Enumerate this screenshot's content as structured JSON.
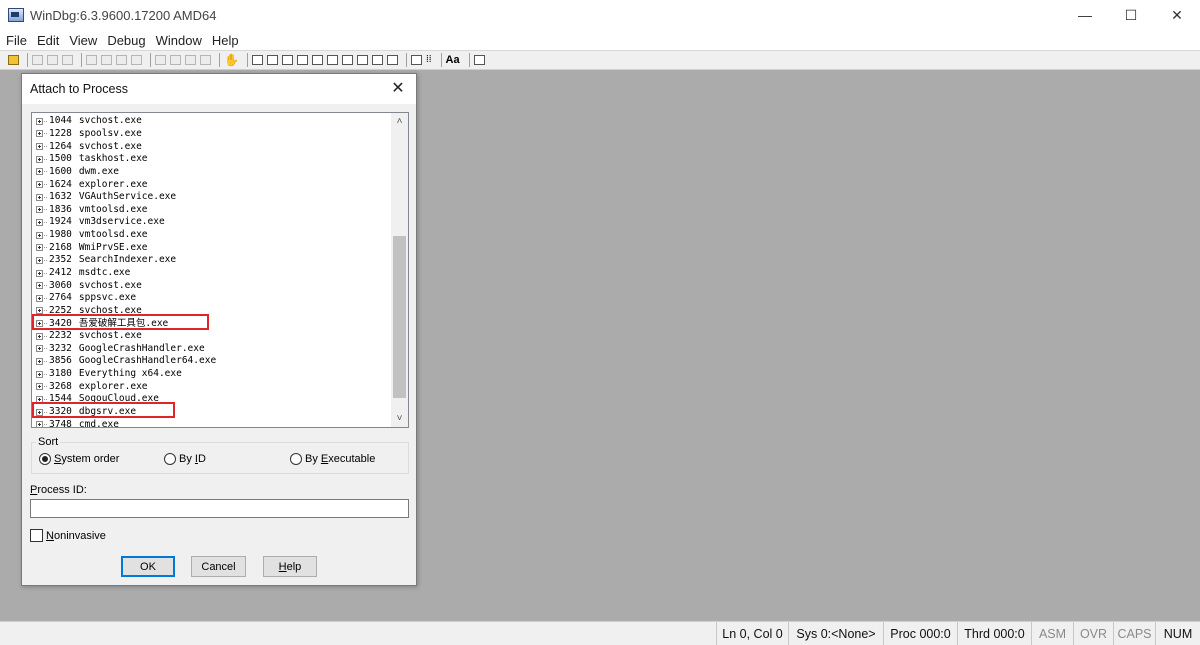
{
  "window": {
    "title": "WinDbg:6.3.9600.17200 AMD64",
    "controls": {
      "minimize": "—",
      "maximize": "☐",
      "close": "✕"
    }
  },
  "menu": [
    "File",
    "Edit",
    "View",
    "Debug",
    "Window",
    "Help"
  ],
  "dialog": {
    "title": "Attach to Process",
    "close": "✕",
    "processes": [
      {
        "pid": "1044",
        "name": "svchost.exe"
      },
      {
        "pid": "1228",
        "name": "spoolsv.exe"
      },
      {
        "pid": "1264",
        "name": "svchost.exe"
      },
      {
        "pid": "1500",
        "name": "taskhost.exe"
      },
      {
        "pid": "1600",
        "name": "dwm.exe"
      },
      {
        "pid": "1624",
        "name": "explorer.exe"
      },
      {
        "pid": "1632",
        "name": "VGAuthService.exe"
      },
      {
        "pid": "1836",
        "name": "vmtoolsd.exe"
      },
      {
        "pid": "1924",
        "name": "vm3dservice.exe"
      },
      {
        "pid": "1980",
        "name": "vmtoolsd.exe"
      },
      {
        "pid": "2168",
        "name": "WmiPrvSE.exe"
      },
      {
        "pid": "2352",
        "name": "SearchIndexer.exe"
      },
      {
        "pid": "2412",
        "name": "msdtc.exe"
      },
      {
        "pid": "3060",
        "name": "svchost.exe"
      },
      {
        "pid": "2764",
        "name": "sppsvc.exe"
      },
      {
        "pid": "2252",
        "name": "svchost.exe"
      },
      {
        "pid": "3420",
        "name": "吾爱破解工具包.exe"
      },
      {
        "pid": "2232",
        "name": "svchost.exe"
      },
      {
        "pid": "3232",
        "name": "GoogleCrashHandler.exe"
      },
      {
        "pid": "3856",
        "name": "GoogleCrashHandler64.exe"
      },
      {
        "pid": "3180",
        "name": "Everything x64.exe"
      },
      {
        "pid": "3268",
        "name": "explorer.exe"
      },
      {
        "pid": "1544",
        "name": "SogouCloud.exe"
      },
      {
        "pid": "3320",
        "name": "dbgsrv.exe"
      },
      {
        "pid": "3748",
        "name": "cmd.exe"
      }
    ],
    "scroll_up": "˄",
    "scroll_down": "˅",
    "sort": {
      "label": "Sort",
      "options": [
        "System order",
        "By ID",
        "By Executable"
      ],
      "selected": "System order"
    },
    "process_id_label": "Process ID:",
    "process_id_value": "",
    "noninvasive_label": "Noninvasive",
    "noninvasive_checked": false,
    "buttons": {
      "ok": "OK",
      "cancel": "Cancel",
      "help": "Help"
    }
  },
  "statusbar": [
    "Ln 0, Col 0",
    "Sys 0:<None>",
    "Proc 000:0",
    "Thrd 000:0",
    "ASM",
    "OVR",
    "CAPS",
    "NUM"
  ],
  "colors": {
    "highlight": "#e0242a",
    "default_button": "#0078d7"
  }
}
